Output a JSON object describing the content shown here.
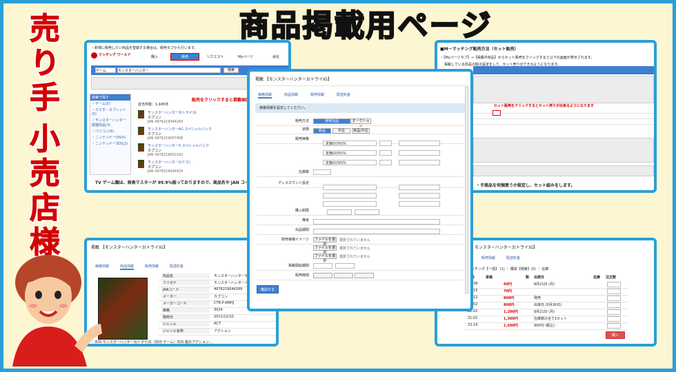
{
  "title": "商品掲載用ページ",
  "side": {
    "seller": "売り手",
    "retailer": "小売店様用"
  },
  "p1": {
    "notice": "・新規に販売したい商品を登録する場合は、販売タブから行います。",
    "logo": "マッチング\nワールド",
    "tabs": [
      "購入",
      "販売",
      "リクエスト",
      "Myページ",
      "会社"
    ],
    "search_category": "ゲーム",
    "search_value": "モンスターハンター",
    "search_btn": "検索",
    "red_note": "販売をクリックすると掲載画面に移ります。",
    "sidebar_title": "検索で探す",
    "sidebar_items": [
      "・ゲーム(5)",
      "・スマホ・タブレット(5)",
      "・モンスターハンター関連商品(3)",
      "・パソコン(6)",
      "・ニンテンドーDS(5)",
      "・ニンテンドー3DS(2)"
    ],
    "count_text": "該当件数：1,445件",
    "items": [
      {
        "name": "モンスターハンター3(トライ)G",
        "maker": "カプコン",
        "jan": "JAN 4976219044269"
      },
      {
        "name": "モンスターハンター4G スペシャルパック",
        "maker": "カプコン",
        "jan": "JAN 4976219057456"
      },
      {
        "name": "モンスターハンター4 スペシャルパック",
        "maker": "カプコン",
        "jan": "JAN 4976219052161"
      },
      {
        "name": "モンスターハンター2(ドス)",
        "maker": "カプコン",
        "jan": "JAN 4976219044924"
      }
    ],
    "bottom_note": "TV ゲーム類は、発表マスターが 99.9%揃っておりますので、商品名や JAN コードで検索可能"
  },
  "p2": {
    "header": "掲載 【モンスターハンター3(トライ)G】",
    "tabs": [
      "価格情報",
      "商品情報",
      "販売情報",
      "配送料金"
    ],
    "info": "価格情報を設定してください。",
    "labels": [
      "販売方法",
      "状態",
      "販売価格",
      "在庫数",
      "ディスカウント設定",
      "購入制限",
      "備考",
      "出品期間",
      "販売価格イメージ",
      "掲載開始期間",
      "販売時間"
    ],
    "condition_opts": [
      "新品",
      "中古",
      "新品/中古"
    ],
    "price_opts": [
      "定価の(50)%",
      "定価の(50)%",
      "定価の(50)%"
    ],
    "file_btn": "ファイルを選択",
    "file_none": "選択されていません",
    "submit": "確認する"
  },
  "p3": {
    "title": "■M－マッチング販売方法（セット販売）",
    "desc1": "・【Myページタブ】→【掲載中商品】からセット販売をクリックすると以下の画面が表示されます。",
    "desc2": "掲載している商品の梱子設定をして、セット売りができるようになります。",
    "red_note": "セット販売をクリックするとセット売りが出来るようになります",
    "bottom_note": "・子商品を何個買うか設定し、セット組みをします。"
  },
  "p4": {
    "header": "掲載 【モンスターハンター3(トライ)G】",
    "tabs": [
      "価格情報",
      "商品情報",
      "販売情報",
      "配送料金"
    ],
    "rows": [
      [
        "商品名",
        "モンスターハンター3(トライ)G"
      ],
      [
        "フリガナ",
        "モンスターハンタートライジー"
      ],
      [
        "JANコード",
        "4976219044269"
      ],
      [
        "メーカー",
        "カプコン"
      ],
      [
        "メーカーコード",
        "CTR-P-AMHJ"
      ],
      [
        "価格",
        "3024"
      ],
      [
        "発売日",
        "2011/12/10"
      ],
      [
        "ジャンル",
        "ACT"
      ],
      [
        "ジャンル名称",
        "アクション"
      ]
    ],
    "caption": "・3DS モンスターハンター3(トライ)G（3DS ゲーム）3DS 版のアクション..."
  },
  "p5": {
    "header": "モンスターハンター3(トライ)G】",
    "tabs": [
      "販売情報",
      "配送料金"
    ],
    "nav": "マッチング【一括】 (1) ｜ 購買【検索】(0) ｜ 在庫",
    "cols": [
      "番号",
      "単価",
      "数",
      "出荷日",
      "在庫",
      "注文数"
    ],
    "rows": [
      [
        "11:38",
        "60円",
        "8月21日 (月)"
      ],
      [
        "13:15",
        "70円",
        ""
      ],
      [
        "14:22",
        "800円",
        "発売"
      ],
      [
        "14:02",
        "800円",
        "出荷日 (5月26日)"
      ],
      [
        "21:02",
        "1,200円",
        "8月21日 (月)"
      ],
      [
        "21:02",
        "1,300円",
        "在庫数の全て1セット"
      ],
      [
        "23:19",
        "1,500円",
        "900円 (税込)"
      ]
    ],
    "buy": "購入"
  }
}
